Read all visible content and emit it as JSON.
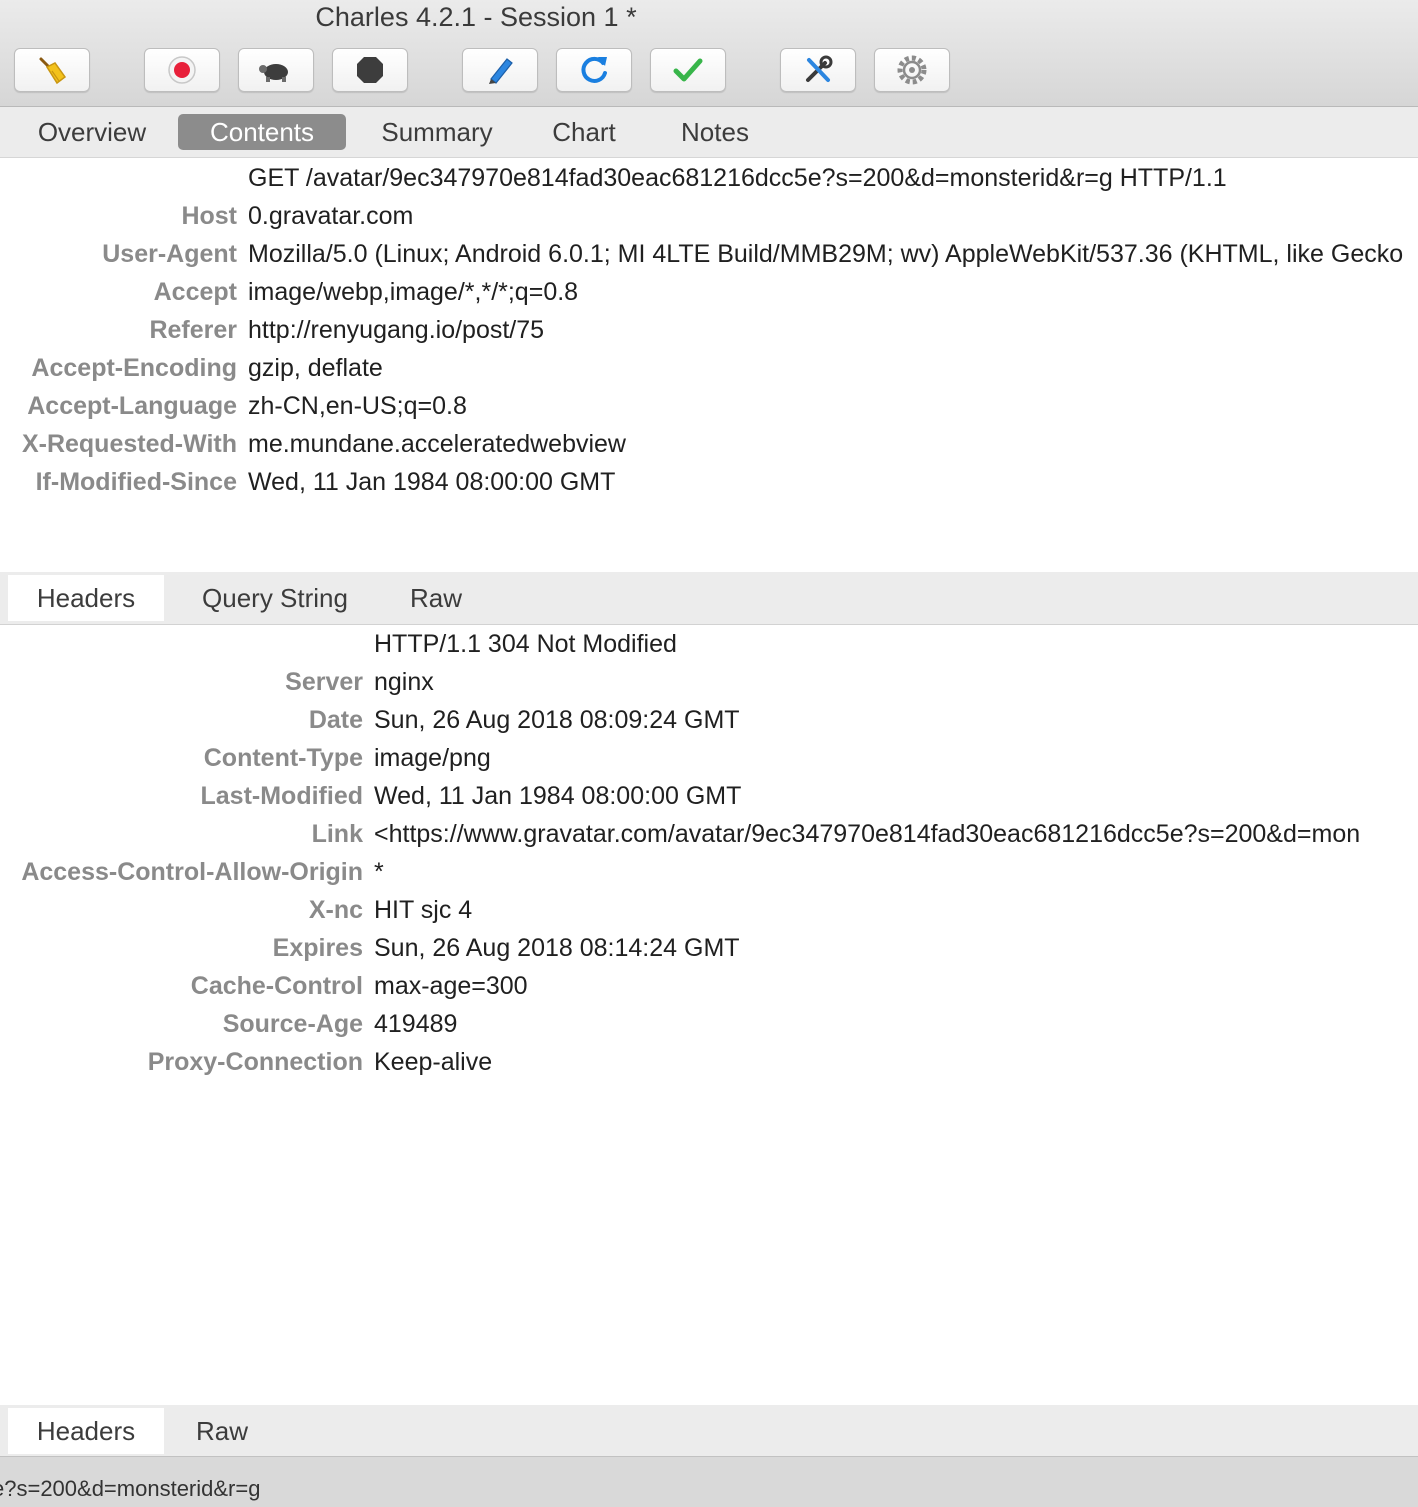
{
  "window": {
    "title": "Charles 4.2.1 - Session 1 *"
  },
  "toolbar": [
    {
      "icon": "broom-icon",
      "label": ""
    },
    {
      "icon": "record-icon",
      "label": ""
    },
    {
      "icon": "turtle-icon",
      "label": ""
    },
    {
      "icon": "stop-icon",
      "label": ""
    },
    {
      "icon": "pen-icon",
      "label": ""
    },
    {
      "icon": "refresh-icon",
      "label": ""
    },
    {
      "icon": "check-icon",
      "label": ""
    },
    {
      "icon": "tools-icon",
      "label": ""
    },
    {
      "icon": "gear-icon",
      "label": ""
    }
  ],
  "tabs": {
    "items": [
      "Overview",
      "Contents",
      "Summary",
      "Chart",
      "Notes"
    ],
    "selected": "Contents"
  },
  "request": {
    "request_line": "GET /avatar/9ec347970e814fad30eac681216dcc5e?s=200&d=monsterid&r=g HTTP/1.1",
    "headers": [
      {
        "name": "Host",
        "value": "0.gravatar.com"
      },
      {
        "name": "User-Agent",
        "value": "Mozilla/5.0 (Linux; Android 6.0.1; MI 4LTE Build/MMB29M; wv) AppleWebKit/537.36 (KHTML, like Gecko"
      },
      {
        "name": "Accept",
        "value": "image/webp,image/*,*/*;q=0.8"
      },
      {
        "name": "Referer",
        "value": "http://renyugang.io/post/75"
      },
      {
        "name": "Accept-Encoding",
        "value": "gzip, deflate"
      },
      {
        "name": "Accept-Language",
        "value": "zh-CN,en-US;q=0.8"
      },
      {
        "name": "X-Requested-With",
        "value": "me.mundane.acceleratedwebview"
      },
      {
        "name": "If-Modified-Since",
        "value": "Wed, 11 Jan 1984 08:00:00 GMT"
      }
    ],
    "subtabs": [
      "Headers",
      "Query String",
      "Raw"
    ],
    "subtab_selected": "Headers"
  },
  "response": {
    "status_line": "HTTP/1.1 304 Not Modified",
    "headers": [
      {
        "name": "Server",
        "value": "nginx"
      },
      {
        "name": "Date",
        "value": "Sun, 26 Aug 2018 08:09:24 GMT"
      },
      {
        "name": "Content-Type",
        "value": "image/png"
      },
      {
        "name": "Last-Modified",
        "value": "Wed, 11 Jan 1984 08:00:00 GMT"
      },
      {
        "name": "Link",
        "value": "<https://www.gravatar.com/avatar/9ec347970e814fad30eac681216dcc5e?s=200&d=mon"
      },
      {
        "name": "Access-Control-Allow-Origin",
        "value": "*"
      },
      {
        "name": "X-nc",
        "value": "HIT sjc 4"
      },
      {
        "name": "Expires",
        "value": "Sun, 26 Aug 2018 08:14:24 GMT"
      },
      {
        "name": "Cache-Control",
        "value": "max-age=300"
      },
      {
        "name": "Source-Age",
        "value": "419489"
      },
      {
        "name": "Proxy-Connection",
        "value": "Keep-alive"
      }
    ],
    "subtabs": [
      "Headers",
      "Raw"
    ],
    "subtab_selected": "Headers"
  },
  "status": {
    "text": "e?s=200&d=monsterid&r=g"
  },
  "colors": {
    "active_tab": "#8c8c8c",
    "record_red": "#e8203a",
    "refresh_blue": "#1a7fe0",
    "check_green": "#38b54a"
  }
}
